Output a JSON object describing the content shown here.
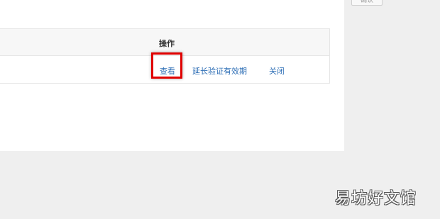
{
  "top_button": {
    "label": "确认"
  },
  "table": {
    "header": {
      "operations": "操作"
    },
    "row": {
      "actions": {
        "view": "查看",
        "extend": "延长验证有效期",
        "close": "关闭"
      }
    }
  },
  "highlight_color": "#e00000",
  "link_color": "#2f6fb6",
  "watermark": "易坊好文馆"
}
